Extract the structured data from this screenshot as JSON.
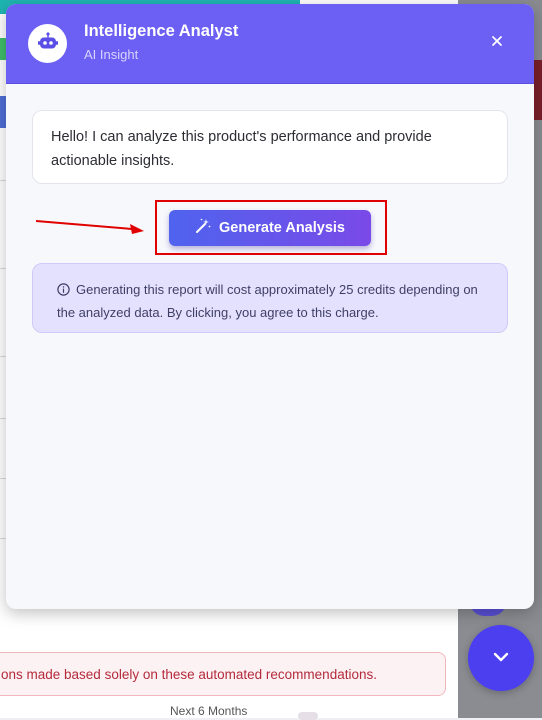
{
  "dialog": {
    "title": "Intelligence Analyst",
    "subtitle": "AI Insight",
    "close_icon": "close-icon",
    "avatar_icon": "robot-icon"
  },
  "chat": {
    "message": "Hello! I can analyze this product's performance and provide actionable insights."
  },
  "actions": {
    "generate_label": "Generate Analysis",
    "generate_icon": "magic-wand-icon"
  },
  "notice": {
    "icon": "info-icon",
    "text": "Generating this report will cost approximately 25 credits depending on the analyzed data. By clicking, you agree to this charge."
  },
  "background": {
    "alert_text": "ons made based solely on these automated recommendations.",
    "bottom_text": "Next 6 Months"
  },
  "fab": {
    "icon": "chevron-down-icon"
  },
  "colors": {
    "header": "#6c5ff4",
    "button_start": "#4f63ee",
    "button_end": "#7a4ae8",
    "notice_bg": "#e4e1ff",
    "highlight": "#e00000",
    "fab": "#4b3ff0"
  }
}
